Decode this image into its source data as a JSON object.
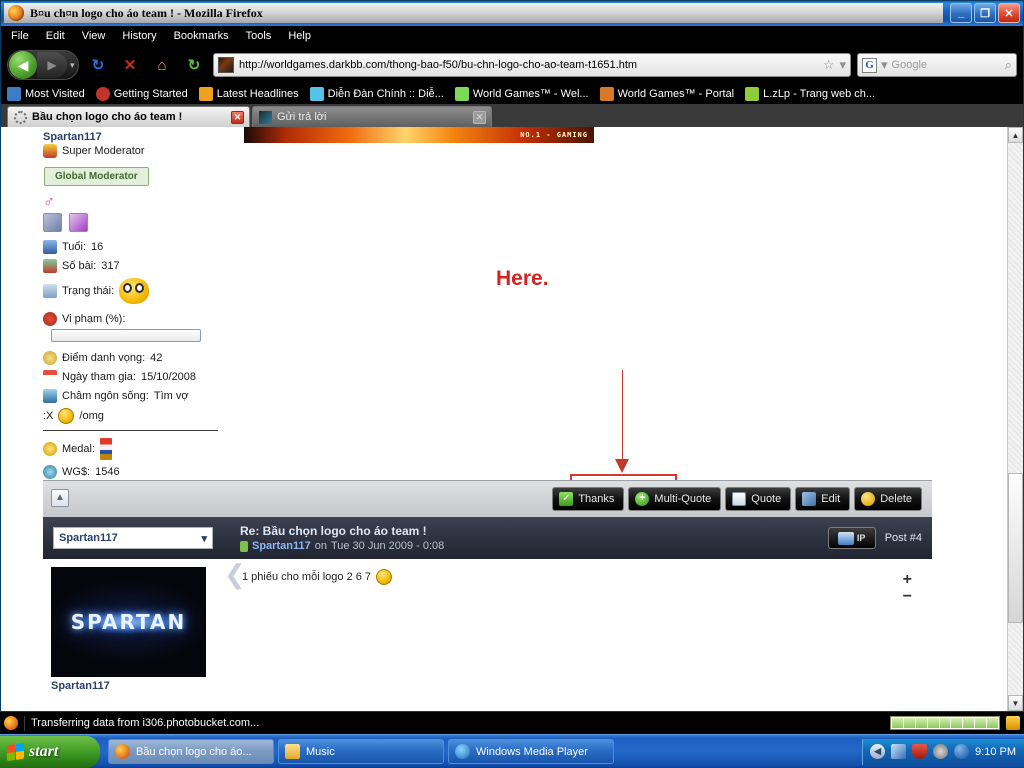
{
  "window": {
    "title": "B¤u ch¤n logo cho áo team ! - Mozilla Firefox",
    "minimize": "_",
    "maximize": "❐",
    "close": "✕"
  },
  "menubar": [
    "File",
    "Edit",
    "View",
    "History",
    "Bookmarks",
    "Tools",
    "Help"
  ],
  "toolbar": {
    "back_icon": "◀",
    "forward_icon": "▶",
    "history_caret": "▾",
    "reload_icon": "↻",
    "stop_icon": "✕",
    "home_icon": "⌂",
    "feed_icon": "↻",
    "url": "http://worldgames.darkbb.com/thong-bao-f50/bu-chn-logo-cho-ao-team-t1651.htm",
    "star_icon": "☆",
    "star_caret": "▾",
    "search_engine": "G",
    "search_caret": "▾",
    "search_placeholder": "Google",
    "search_icon": "⌕"
  },
  "bookmarks": [
    {
      "label": "Most Visited",
      "color": "#3d7ec2"
    },
    {
      "label": "Getting Started",
      "color": "#c2342a"
    },
    {
      "label": "Latest Headlines",
      "color": "#f0a020"
    },
    {
      "label": "Diễn Đàn Chính :: Diễ...",
      "color": "#55c3e8"
    },
    {
      "label": "World Games™ - Wel...",
      "color": "#7ed957"
    },
    {
      "label": "World Games™ - Portal",
      "color": "#d8792a"
    },
    {
      "label": "L.zLp - Trang web ch...",
      "color": "#8fce3a"
    }
  ],
  "tabs": [
    {
      "label": "Bầu chọn logo cho áo team !",
      "active": true,
      "close": "✕"
    },
    {
      "label": "Gửi trả lời",
      "active": false,
      "close": "✕"
    }
  ],
  "page": {
    "banner_text": "NO.1 - GAMING",
    "profile": {
      "username": "Spartan117",
      "rank_title": "Super Moderator",
      "rank_badge": "Global Moderator",
      "gender_symbol": "♂",
      "stats": [
        {
          "label": "Tuổi:",
          "value": "16"
        },
        {
          "label": "Số bài:",
          "value": "317"
        },
        {
          "label": "Trạng thái:",
          "value": ""
        },
        {
          "label": "Vi phạm (%):",
          "value": ""
        }
      ],
      "details": [
        {
          "label": "Điểm danh vọng:",
          "value": "42"
        },
        {
          "label": "Ngày tham gia:",
          "value": "15/10/2008"
        },
        {
          "label": "Châm ngôn sống:",
          "value": "Tìm vợ"
        }
      ],
      "mood_prefix": ":X",
      "mood_text": "/omg",
      "medal_label": "Medal:",
      "money_label": "WG$:",
      "money_value": "1546"
    },
    "annotation": {
      "text": "Here.",
      "color": "#d32323"
    },
    "post_buttons": [
      {
        "label": "Thanks",
        "icon": "check-icon"
      },
      {
        "label": "Multi-Quote",
        "icon": "plus-icon"
      },
      {
        "label": "Quote",
        "icon": "quote-icon"
      },
      {
        "label": "Edit",
        "icon": "wrench-icon"
      },
      {
        "label": "Delete",
        "icon": "power-icon"
      }
    ],
    "collapse_icon": "▲",
    "post": {
      "user_select": "Spartan117",
      "select_caret": "▾",
      "title": "Re: Bầu chọn logo cho áo team !",
      "author": "Spartan117",
      "meta_on": "on",
      "date": "Tue 30 Jun 2009 - 0:08",
      "ip_label": "IP",
      "post_number": "Post #4",
      "avatar_text": "SPARTAN",
      "avatar_name": "Spartan117",
      "body_text": "1 phiếu cho mỗi logo 2 6 7",
      "rate_plus": "+",
      "rate_minus": "−"
    }
  },
  "statusbar": {
    "text": "Transferring data from i306.photobucket.com...",
    "progress_segments": 9
  },
  "taskbar": {
    "start_label": "start",
    "items": [
      {
        "label": "Bầu chọn logo cho áo...",
        "icon": "firefox-icon",
        "active": true
      },
      {
        "label": "Music",
        "icon": "folder-icon",
        "active": false
      },
      {
        "label": "Windows Media Player",
        "icon": "media-player-icon",
        "active": false
      }
    ],
    "tray": {
      "expand_icon": "◀",
      "icons": [
        "network-icon",
        "security-shield-icon",
        "volume-icon",
        "update-icon"
      ],
      "clock": "9:10 PM"
    }
  },
  "scrollbar": {
    "up_icon": "▲",
    "down_icon": "▼"
  }
}
